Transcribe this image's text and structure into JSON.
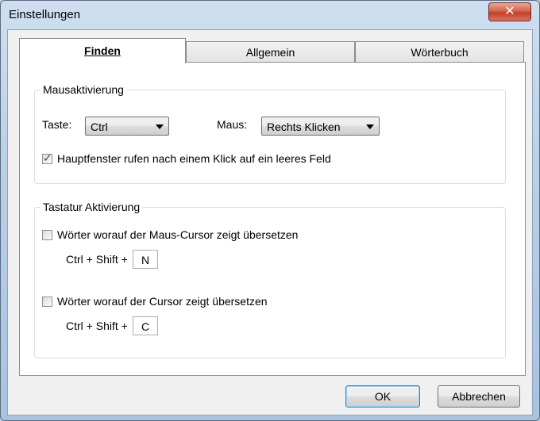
{
  "window": {
    "title": "Einstellungen",
    "close_glyph": "✕"
  },
  "tabs": [
    {
      "label": "Finden",
      "active": true
    },
    {
      "label": "Allgemein",
      "active": false
    },
    {
      "label": "Wörterbuch",
      "active": false
    }
  ],
  "mouse_group": {
    "legend": "Mausaktivierung",
    "taste_label": "Taste:",
    "taste_value": "Ctrl",
    "maus_label": "Maus:",
    "maus_value": "Rechts Klicken",
    "checkbox_label": "Hauptfenster rufen nach einem Klick auf ein leeres Feld",
    "checkbox_checked": true
  },
  "keyboard_group": {
    "legend": "Tastatur Aktivierung",
    "option1_label": "Wörter worauf der Maus-Cursor zeigt übersetzen",
    "option1_checked": false,
    "option1_shortcut_prefix": "Ctrl + Shift +",
    "option1_key": "N",
    "option2_label": "Wörter worauf der Cursor zeigt übersetzen",
    "option2_checked": false,
    "option2_shortcut_prefix": "Ctrl + Shift +",
    "option2_key": "C"
  },
  "buttons": {
    "ok": "OK",
    "cancel": "Abbrechen"
  },
  "icons": {
    "dropdown": "chevron-down-icon",
    "checkmark": "checkmark-icon"
  }
}
